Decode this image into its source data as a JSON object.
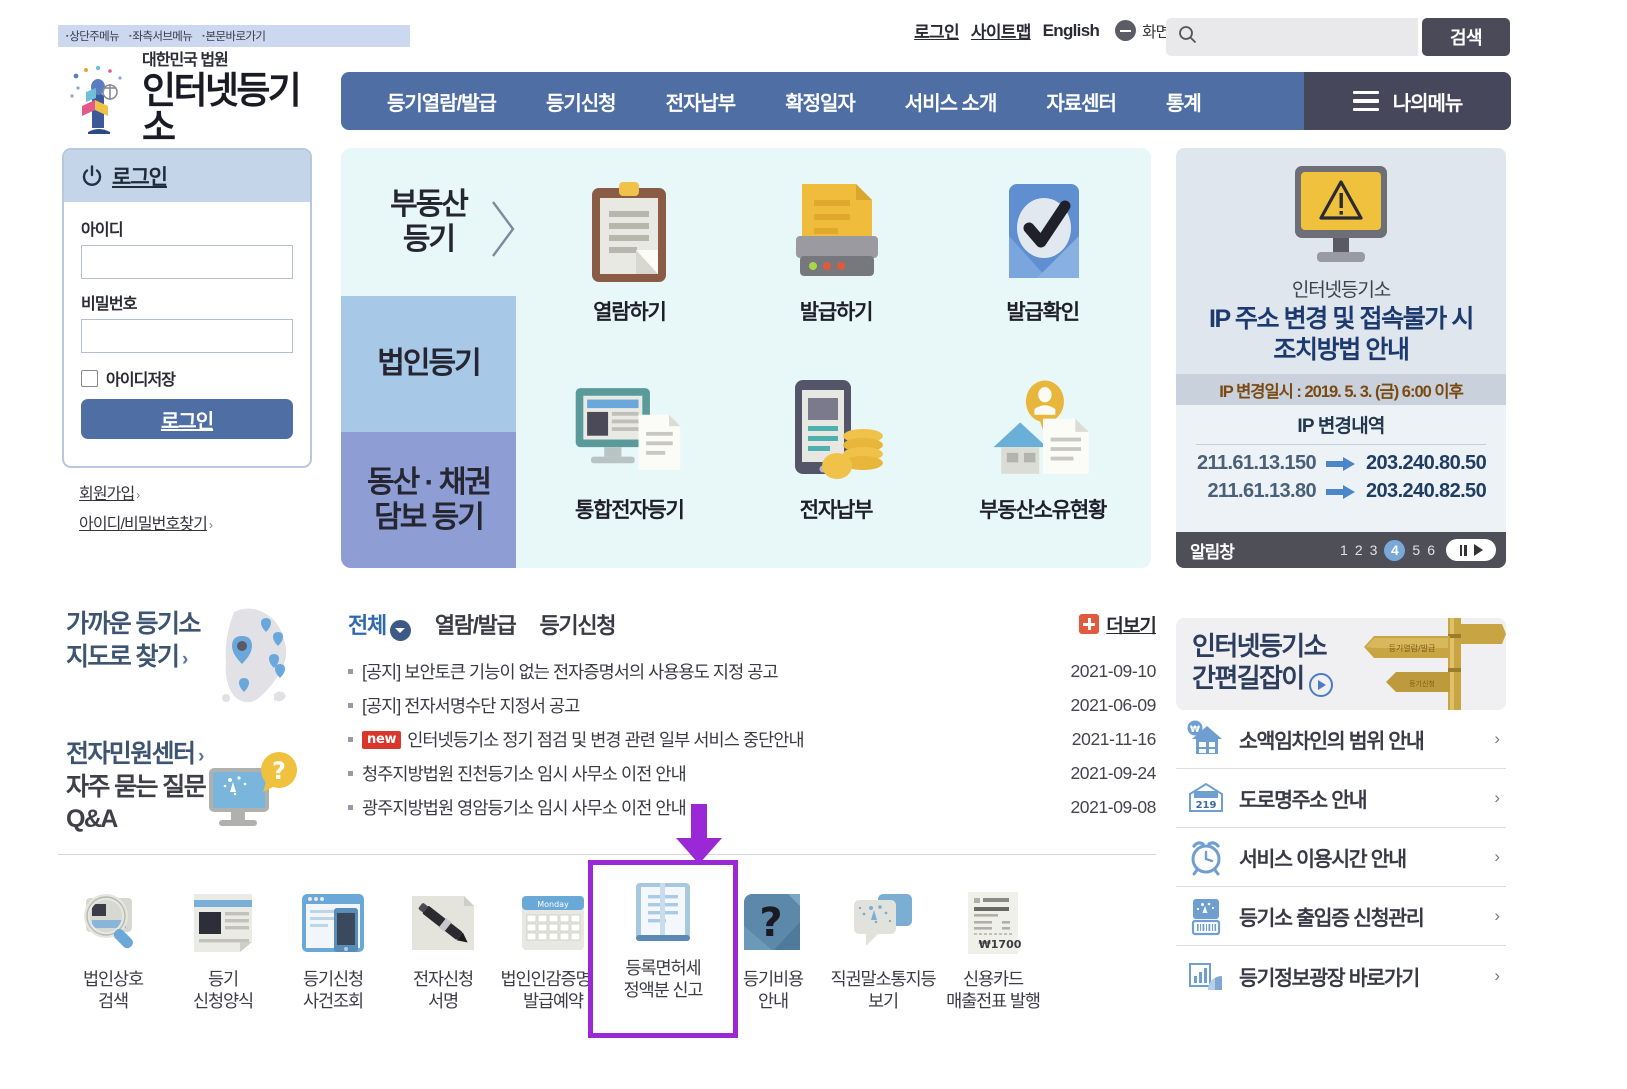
{
  "skipnav": {
    "items": [
      "상단주메뉴",
      "좌측서브메뉴",
      "본문바로가기"
    ]
  },
  "utility": {
    "login": "로그인",
    "sitemap": "사이트맵",
    "english": "English",
    "zoom_label": "화면크기",
    "search_placeholder": "",
    "search_value": "",
    "search_button": "검색"
  },
  "logo": {
    "sub": "대한민국 법원",
    "main": "인터넷등기소"
  },
  "gnb": {
    "items": [
      "등기열람/발급",
      "등기신청",
      "전자납부",
      "확정일자",
      "서비스 소개",
      "자료센터",
      "통계"
    ],
    "mymenu": "나의메뉴"
  },
  "login_panel": {
    "title": "로그인",
    "id_label": "아이디",
    "id_value": "",
    "pw_label": "비밀번호",
    "pw_value": "",
    "remember_label": "아이디저장",
    "submit": "로그인",
    "join": "회원가입",
    "find": "아이디/비밀번호찾기"
  },
  "hero": {
    "categories": [
      "부동산\n등기",
      "법인등기",
      "동산 · 채권\n담보 등기"
    ],
    "cat1_line1": "부동산",
    "cat1_line2": "등기",
    "cat2": "법인등기",
    "cat3_line1": "동산 · 채권",
    "cat3_line2": "담보 등기",
    "tiles": [
      {
        "label": "열람하기",
        "icon": "clipboard-icon"
      },
      {
        "label": "발급하기",
        "icon": "printer-icon"
      },
      {
        "label": "발급확인",
        "icon": "check-badge-icon"
      },
      {
        "label": "통합전자등기",
        "icon": "monitor-document-icon"
      },
      {
        "label": "전자납부",
        "icon": "mobile-coins-icon"
      },
      {
        "label": "부동산소유현황",
        "icon": "house-person-icon"
      }
    ]
  },
  "ip_panel": {
    "sub": "인터넷등기소",
    "title_line1": "IP 주소 변경 및 접속불가 시",
    "title_line2": "조치방법 안내",
    "date_line": "IP 변경일시 : 2019. 5. 3. (금) 6:00 이후",
    "table_head": "IP 변경내역",
    "rows": [
      {
        "old": "211.61.13.150",
        "new": "203.240.80.50"
      },
      {
        "old": "211.61.13.80",
        "new": "203.240.82.50"
      }
    ],
    "foot_label": "알림창",
    "pages": [
      "1",
      "2",
      "3",
      "4",
      "5",
      "6"
    ],
    "current_page": "4"
  },
  "midleft": {
    "map_line1": "가까운 등기소",
    "map_line2": "지도로 찾기",
    "center_link": "전자민원센터",
    "qna_line1": "자주 묻는 질문",
    "qna_line2": "Q&A"
  },
  "notice": {
    "tabs": [
      {
        "label": "전체",
        "active": true
      },
      {
        "label": "열람/발급",
        "active": false
      },
      {
        "label": "등기신청",
        "active": false
      }
    ],
    "more": "더보기",
    "rows": [
      {
        "title": "[공지] 보안토큰 기능이 없는 전자증명서의 사용용도 지정 공고",
        "date": "2021-09-10",
        "new": false
      },
      {
        "title": "[공지] 전자서명수단 지정서 공고",
        "date": "2021-06-09",
        "new": false
      },
      {
        "title": "인터넷등기소 정기 점검 및 변경 관련 일부 서비스 중단안내",
        "date": "2021-11-16",
        "new": true,
        "badge": "new"
      },
      {
        "title": "청주지방법원 진천등기소 임시 사무소 이전 안내",
        "date": "2021-09-24",
        "new": false
      },
      {
        "title": "광주지방법원 영암등기소 임시 사무소 이전 안내",
        "date": "2021-09-08",
        "new": false
      }
    ]
  },
  "quicklinks": [
    {
      "line1": "법인상호",
      "line2": "검색",
      "icon": "magnifier-icon",
      "highlighted": false
    },
    {
      "line1": "등기",
      "line2": "신청양식",
      "icon": "document-form-icon",
      "highlighted": false
    },
    {
      "line1": "등기신청",
      "line2": "사건조회",
      "icon": "browser-mobile-icon",
      "highlighted": false
    },
    {
      "line1": "전자신청",
      "line2": "서명",
      "icon": "pen-icon",
      "highlighted": false
    },
    {
      "line1": "법인인감증명서",
      "line2": "발급예약",
      "icon": "calendar-icon",
      "highlighted": false
    },
    {
      "line1": "등록면허세",
      "line2": "정액분 신고",
      "icon": "book-document-icon",
      "highlighted": true
    },
    {
      "line1": "등기비용",
      "line2": "안내",
      "icon": "question-icon",
      "highlighted": false
    },
    {
      "line1": "직권말소통지등",
      "line2": "보기",
      "icon": "speech-notice-icon",
      "highlighted": false
    },
    {
      "line1": "신용카드",
      "line2": "매출전표 발행",
      "icon": "receipt-icon",
      "highlighted": false
    }
  ],
  "quick_highlight": {
    "color": "#9b28d6",
    "arrow_color": "#9b28d6"
  },
  "guide": {
    "head_line1": "인터넷등기소",
    "head_line2": "간편길잡이",
    "items": [
      {
        "label": "소액임차인의 범위 안내",
        "icon": "house-won-icon"
      },
      {
        "label": "도로명주소 안내",
        "icon": "address-sign-icon"
      },
      {
        "label": "서비스 이용시간 안내",
        "icon": "alarm-clock-icon"
      },
      {
        "label": "등기소 출입증 신청관리",
        "icon": "id-card-icon"
      },
      {
        "label": "등기정보광장 바로가기",
        "icon": "chart-icon"
      }
    ]
  },
  "colors": {
    "brand_blue": "#4f6fa4",
    "dark_nav": "#47475c",
    "hero_bg": "#e8f7f7",
    "highlight_purple": "#9b28d6",
    "badge_red": "#d9372b"
  }
}
